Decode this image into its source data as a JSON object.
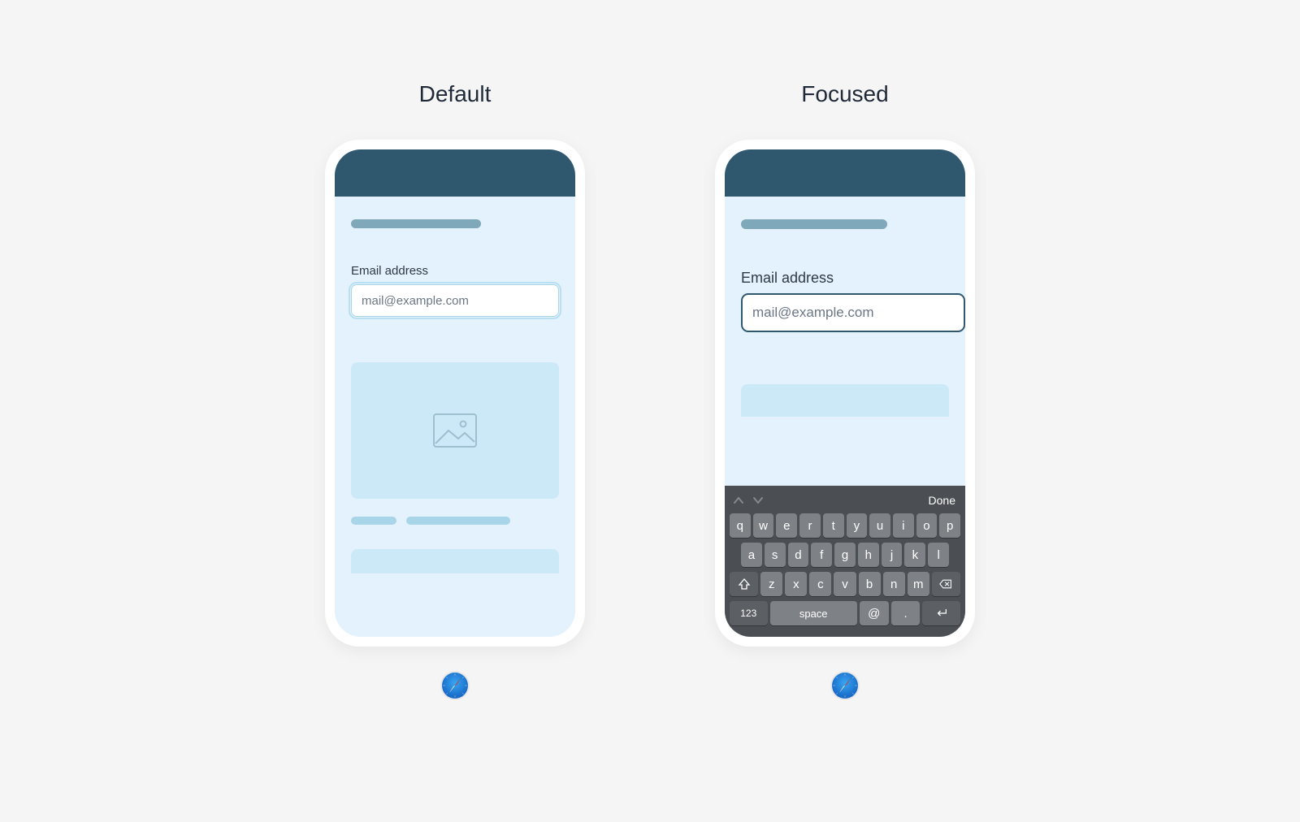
{
  "titles": {
    "default": "Default",
    "focused": "Focused"
  },
  "form": {
    "label": "Email address",
    "placeholder": "mail@example.com"
  },
  "keyboard": {
    "done": "Done",
    "row1": [
      "q",
      "w",
      "e",
      "r",
      "t",
      "y",
      "u",
      "i",
      "o",
      "p"
    ],
    "row2": [
      "a",
      "s",
      "d",
      "f",
      "g",
      "h",
      "j",
      "k",
      "l"
    ],
    "row3": [
      "z",
      "x",
      "c",
      "v",
      "b",
      "n",
      "m"
    ],
    "numKey": "123",
    "space": "space",
    "at": "@",
    "dot": "."
  }
}
